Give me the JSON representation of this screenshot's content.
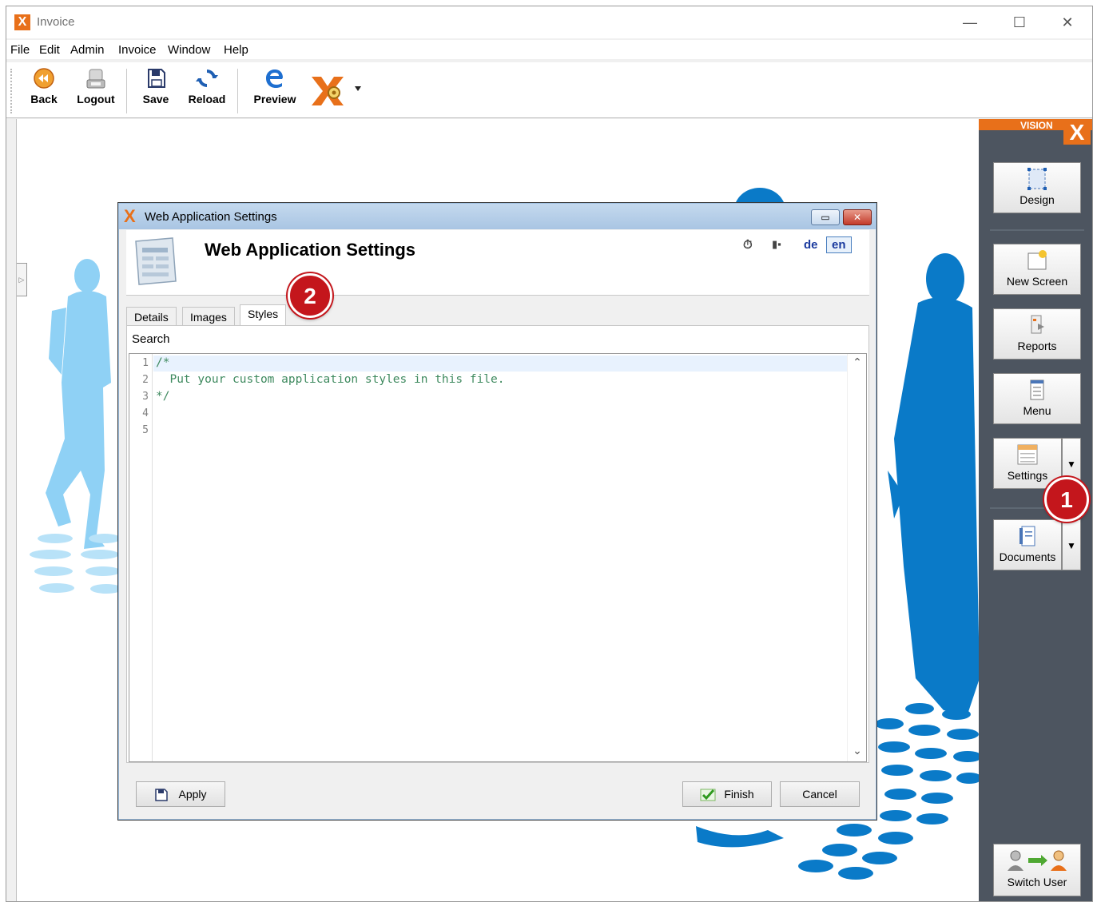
{
  "window": {
    "app_letter": "X",
    "title": "Invoice",
    "minimize": "—",
    "maximize": "☐",
    "close": "✕"
  },
  "menu": [
    "File",
    "Edit",
    "Admin",
    "Invoice",
    "Window",
    "Help"
  ],
  "toolbar": {
    "back": "Back",
    "logout": "Logout",
    "save": "Save",
    "reload": "Reload",
    "preview": "Preview"
  },
  "right_panel": {
    "brand": "VISION",
    "brand_x": "X",
    "design": "Design",
    "new_screen": "New Screen",
    "reports": "Reports",
    "menu": "Menu",
    "settings": "Settings",
    "documents": "Documents",
    "switch_user": "Switch User"
  },
  "dialog": {
    "window_title": "Web Application Settings",
    "header_title": "Web Application Settings",
    "lang_de": "de",
    "lang_en": "en",
    "tabs": [
      "Details",
      "Images",
      "Styles"
    ],
    "active_tab": "Styles",
    "search_label": "Search",
    "line_numbers": [
      "1",
      "2",
      "3",
      "4",
      "5"
    ],
    "code_lines": [
      "/*",
      "  Put your custom application styles in this file.",
      "*/",
      "",
      ""
    ],
    "apply": "Apply",
    "finish": "Finish",
    "cancel": "Cancel"
  },
  "annotations": {
    "badge_1": "1",
    "badge_2": "2"
  },
  "colors": {
    "accent_orange": "#e8701a",
    "panel_dark": "#4d5560",
    "silhouette_light": "#8fd1f5",
    "silhouette_dark": "#0a7ac8",
    "badge_red": "#c4161c"
  }
}
